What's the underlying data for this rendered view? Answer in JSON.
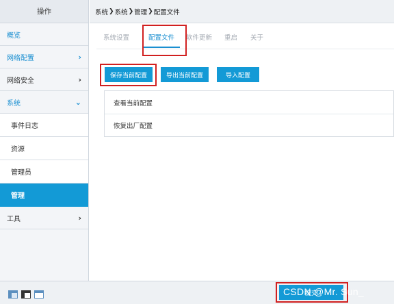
{
  "sidebar": {
    "header": "操作",
    "items": [
      {
        "label": "概览"
      },
      {
        "label": "网络配置"
      },
      {
        "label": "网络安全"
      },
      {
        "label": "系统"
      },
      {
        "label": "工具"
      }
    ],
    "subitems": [
      {
        "label": "事件日志"
      },
      {
        "label": "资源"
      },
      {
        "label": "管理员"
      },
      {
        "label": "管理"
      }
    ]
  },
  "breadcrumb": {
    "parts": [
      "系统",
      "系统",
      "管理",
      "配置文件"
    ],
    "separator": "❯"
  },
  "tabs": [
    {
      "label": "系统设置"
    },
    {
      "label": "配置文件"
    },
    {
      "label": "软件更新"
    },
    {
      "label": "重启"
    },
    {
      "label": "关于"
    }
  ],
  "buttons": {
    "save": "保存当前配置",
    "export": "导出当前配置",
    "import": "导入配置"
  },
  "panel": {
    "rows": [
      {
        "label": "查看当前配置"
      },
      {
        "label": "恢复出厂配置"
      }
    ]
  },
  "footer": {
    "apply_label": "提交",
    "watermark": "CSDN @Mr. Sun_"
  },
  "colors": {
    "accent": "#139ad6",
    "highlight_box": "#d11f1f"
  }
}
